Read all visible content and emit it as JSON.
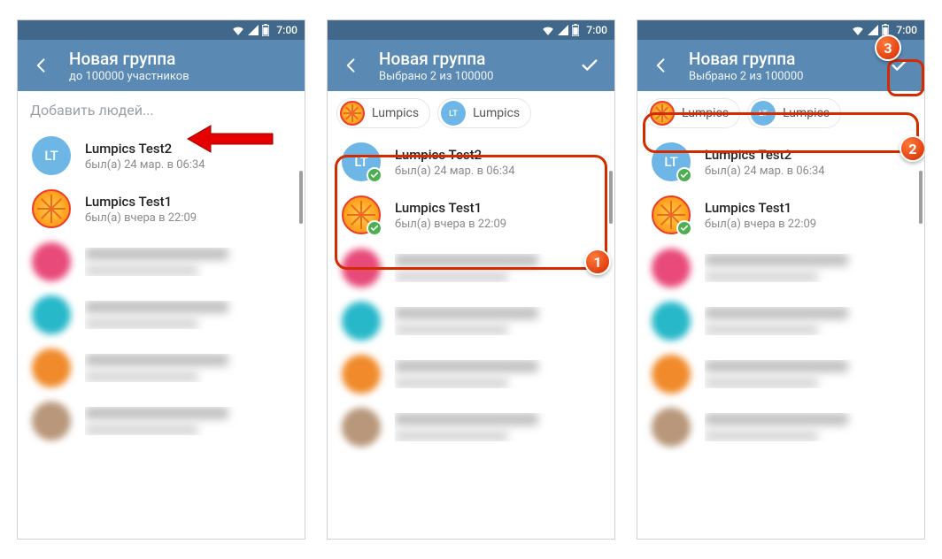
{
  "status_time": "7:00",
  "screens": [
    {
      "header": {
        "title": "Новая группа",
        "subtitle": "до 100000 участников"
      },
      "search_placeholder": "Добавить людей...",
      "show_search": true,
      "show_check": false,
      "chips": [],
      "contacts": [
        {
          "name": "Lumpics Test2",
          "status": "был(а) 24 мар. в 06:34",
          "avatar": "lt",
          "selected": false
        },
        {
          "name": "Lumpics Test1",
          "status": "был(а) вчера в 22:09",
          "avatar": "orange",
          "selected": false
        }
      ],
      "blurred": [
        {
          "color": "#e84a7a"
        },
        {
          "color": "#27b8c9"
        },
        {
          "color": "#f08a2a"
        },
        {
          "color": "#b8977a"
        }
      ]
    },
    {
      "header": {
        "title": "Новая группа",
        "subtitle": "Выбрано 2 из 100000"
      },
      "show_search": false,
      "show_check": true,
      "chips": [
        {
          "label": "Lumpics",
          "avatar": "orange"
        },
        {
          "label": "Lumpics",
          "avatar": "lt"
        }
      ],
      "contacts": [
        {
          "name": "Lumpics Test2",
          "status": "был(а) 24 мар. в 06:34",
          "avatar": "lt",
          "selected": true
        },
        {
          "name": "Lumpics Test1",
          "status": "был(а) вчера в 22:09",
          "avatar": "orange",
          "selected": true
        }
      ],
      "blurred": [
        {
          "color": "#e84a7a"
        },
        {
          "color": "#27b8c9"
        },
        {
          "color": "#f08a2a"
        },
        {
          "color": "#b8977a"
        }
      ],
      "step": "1"
    },
    {
      "header": {
        "title": "Новая группа",
        "subtitle": "Выбрано 2 из 100000"
      },
      "show_search": false,
      "show_check": true,
      "chips": [
        {
          "label": "Lumpics",
          "avatar": "orange"
        },
        {
          "label": "Lumpics",
          "avatar": "lt"
        }
      ],
      "contacts": [
        {
          "name": "Lumpics Test2",
          "status": "был(а) 24 мар. в 06:34",
          "avatar": "lt",
          "selected": true
        },
        {
          "name": "Lumpics Test1",
          "status": "был(а) вчера в 22:09",
          "avatar": "orange",
          "selected": true
        }
      ],
      "blurred": [
        {
          "color": "#e84a7a"
        },
        {
          "color": "#27b8c9"
        },
        {
          "color": "#f08a2a"
        },
        {
          "color": "#b8977a"
        }
      ],
      "step_chips": "2",
      "step_check": "3"
    }
  ]
}
